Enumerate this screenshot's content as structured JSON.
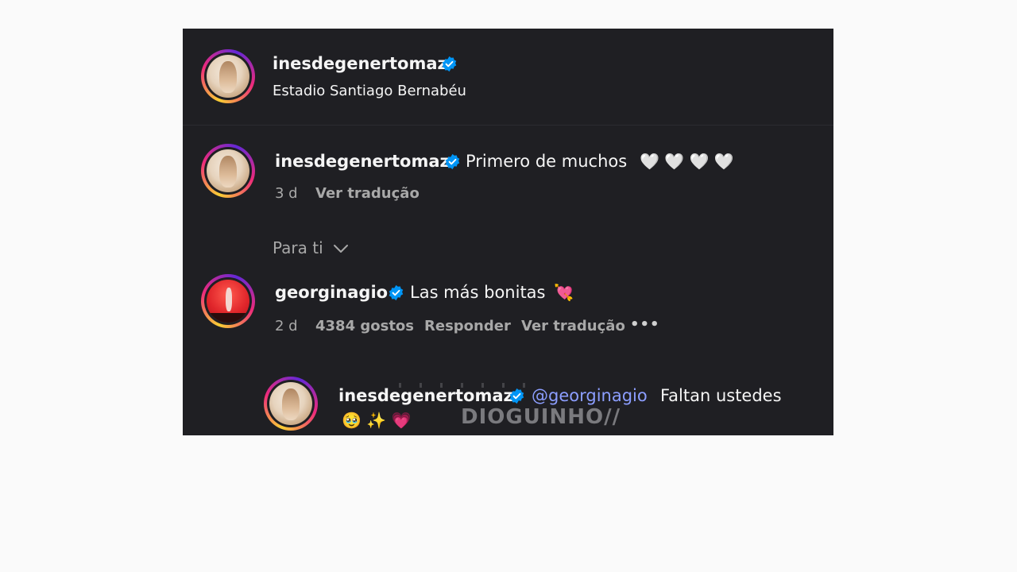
{
  "post": {
    "username": "inesdegenertomaz",
    "location": "Estadio Santiago Bernabéu"
  },
  "caption": {
    "username": "inesdegenertomaz",
    "text": "Primero de muchos",
    "emojis": "🤍 🤍 🤍 🤍",
    "time": "3 d",
    "translate": "Ver tradução"
  },
  "filter": {
    "label": "Para ti"
  },
  "comment": {
    "username": "georginagio",
    "text": "Las más bonitas",
    "emoji": "💘",
    "time": "2 d",
    "likes": "4384 gostos",
    "reply": "Responder",
    "translate": "Ver tradução",
    "more": "•••"
  },
  "reply": {
    "username": "inesdegenertomaz",
    "mention": "@georginagio",
    "text": "Faltan ustedes",
    "emojis": "🥹 ✨ 💗"
  },
  "watermark": "DIOGUINHO//",
  "colors": {
    "background": "#1f1f23",
    "verified": "#0095f6",
    "mention": "#8c9eff"
  }
}
